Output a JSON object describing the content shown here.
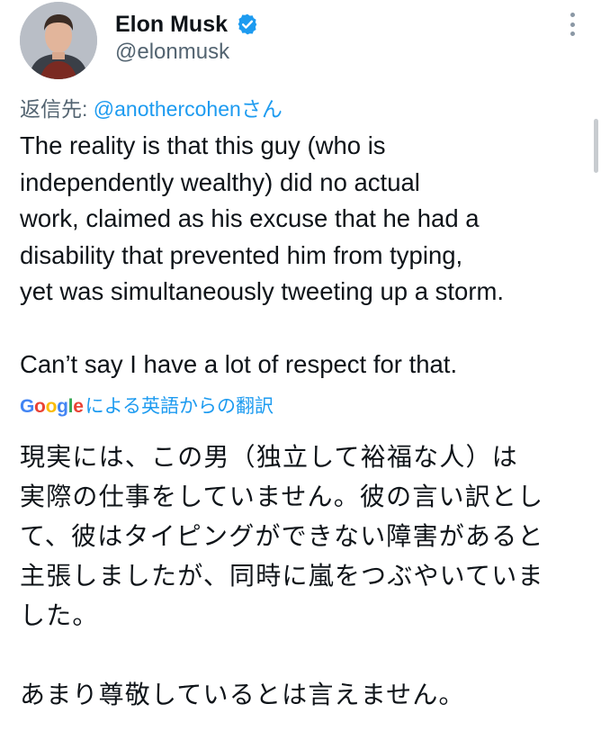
{
  "author": {
    "name": "Elon Musk",
    "handle": "@elonmusk",
    "verified_color": "#1d9bf0",
    "avatar_icon": "profile-photo"
  },
  "reply_to": {
    "prefix": "返信先: ",
    "mention": "@anothercohen",
    "suffix": "さん"
  },
  "tweet": {
    "lines": [
      "The reality is that this guy (who is",
      "independently wealthy) did no actual",
      "work, claimed as his excuse that he had a",
      "disability that prevented him from typing,",
      "yet was simultaneously tweeting up a storm.",
      "",
      "Can’t say I have a lot of respect for that."
    ]
  },
  "translation": {
    "logo": "Google",
    "label": "による英語からの翻訳",
    "logo_colors": [
      "#4285f4",
      "#ea4335",
      "#fbbc05",
      "#4285f4",
      "#34a853",
      "#ea4335"
    ],
    "lines": [
      "現実には、この男（独立して裕福な人）は",
      "実際の仕事をしていません。彼の言い訳とし",
      "て、彼はタイピングができない障害があると",
      "主張しましたが、同時に嵐をつぶやいていま",
      "した。",
      "",
      "あまり尊敬しているとは言えません。"
    ]
  },
  "colors": {
    "text": "#0f1419",
    "secondary": "#536471",
    "link": "#1d9bf0"
  }
}
